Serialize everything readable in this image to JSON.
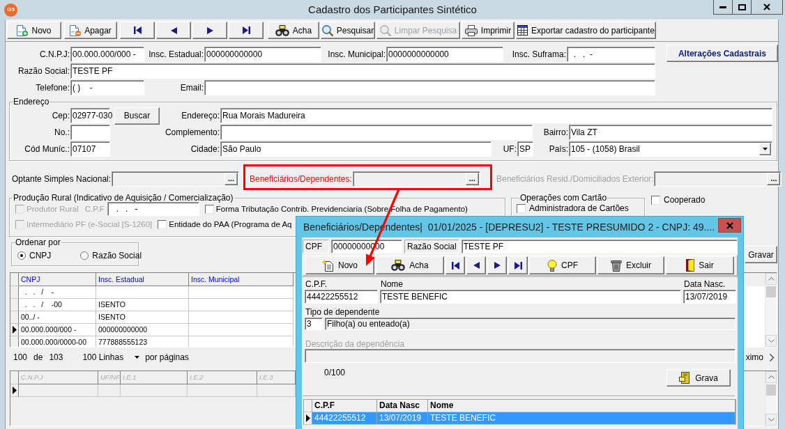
{
  "window": {
    "logo": "G5",
    "title": "Cadastro dos Participantes Sintético"
  },
  "toolbar": [
    {
      "kind": "labeled",
      "label": "Novo",
      "disabled": false
    },
    {
      "kind": "labeled",
      "label": "Apagar",
      "disabled": false
    },
    {
      "kind": "icon",
      "disabled": false
    },
    {
      "kind": "icon",
      "disabled": false
    },
    {
      "kind": "icon",
      "disabled": false
    },
    {
      "kind": "icon",
      "disabled": false
    },
    {
      "kind": "labeled",
      "label": "Acha",
      "disabled": false
    },
    {
      "kind": "labeled",
      "label": "Pesquisar",
      "disabled": false
    },
    {
      "kind": "labeled",
      "label": "Limpar Pesquisa",
      "disabled": true
    },
    {
      "kind": "labeled",
      "label": "Imprimir",
      "disabled": false
    },
    {
      "kind": "labeled",
      "label": "Exportar cadastro do participante",
      "disabled": false
    }
  ],
  "participant": {
    "cnpj": {
      "label": "C.N.P.J:",
      "value": "00.000.000/000 -"
    },
    "insc_estadual": {
      "label": "Insc. Estadual:",
      "value": "000000000000"
    },
    "insc_municipal": {
      "label": "Insc. Municipal:",
      "value": "0000000000000"
    },
    "insc_suframa": {
      "label": "Insc. Suframa:",
      "value": "  .   .  -"
    },
    "changes_button": "Alterações Cadastrais",
    "razao_social": {
      "label": "Razão Social:",
      "value": "TESTE PF"
    },
    "telefone": {
      "label": "Telefone:",
      "value": "( )    -"
    },
    "email": {
      "label": "Email:"
    }
  },
  "address": {
    "title": "Endereço",
    "cep": {
      "label": "Cep:",
      "value": "02977-030"
    },
    "search_button": "Buscar",
    "street": {
      "label": "Endereço:",
      "value": "Rua Morais Madureira"
    },
    "number": {
      "label": "No.:"
    },
    "complement": {
      "label": "Complemento:"
    },
    "district": {
      "label": "Bairro:",
      "value": "Vila ZT"
    },
    "city_code": {
      "label": "Cód Muníc.:",
      "value": "07107"
    },
    "city": {
      "label": "Cidade:",
      "value": "São Paulo"
    },
    "state": {
      "label": "UF:",
      "value": "SP"
    },
    "country": {
      "label": "País:",
      "value": "105 - (1058) Brasil"
    }
  },
  "lookups": [
    {
      "label": "Optante Simples Nacional:",
      "button": "...",
      "disabled": false,
      "highlighted": false
    },
    {
      "label": "Beneficiários/Dependentes:",
      "button": "...",
      "disabled": false,
      "highlighted": true
    },
    {
      "label": "Beneficiários Resid./Domiciliados Exterior:",
      "button": "...",
      "disabled": true,
      "highlighted": false
    }
  ],
  "rural_production": {
    "title": "Produção Rural (Indicativo de Aquisição / Comercialização)",
    "options": [
      {
        "label": "Produtor Rural",
        "checked": false,
        "disabled": true
      },
      {
        "label": "Forma Tributação Contrib. Previdenciaria (Sobre Folha de Pagamento)",
        "checked": false,
        "disabled": false
      },
      {
        "label": "Intermediário PF (e-Social [S-1260]",
        "checked": false,
        "disabled": true
      },
      {
        "label": "Entidade do PAA (Programa de Aq",
        "checked": false,
        "disabled": false
      }
    ],
    "cpf": {
      "label": "C.P.F",
      "value": "   .   .   -",
      "disabled": true
    }
  },
  "card_operations": {
    "title": "Operações com Cartão",
    "options": [
      {
        "label": "Administradora de Cartões",
        "checked": false
      }
    ]
  },
  "cooperado": {
    "label": "Cooperado",
    "checked": false
  },
  "sort_by": {
    "title": "Ordenar por",
    "options": [
      {
        "label": "CNPJ",
        "selected": true
      },
      {
        "label": "Razão Social",
        "selected": false
      }
    ]
  },
  "save_button": "Gravar",
  "participants_table": {
    "columns": [
      "CNPJ",
      "Insc. Estadual",
      "Insc. Municipal"
    ],
    "rows": [
      {
        "cells": [
          "  .   .   /    -"
        ],
        "selected": false
      },
      {
        "cells": [
          "  .   .   /    -00",
          "ISENTO"
        ],
        "selected": false
      },
      {
        "cells": [
          "00../ -",
          "ISENTO"
        ],
        "selected": false
      },
      {
        "cells": [
          "00.000.000/000 -",
          "000000000000"
        ],
        "selected": true
      },
      {
        "cells": [
          "00.000.000/0000-00",
          "777888555123"
        ],
        "selected": false
      }
    ]
  },
  "pagination": {
    "shown": "100",
    "of": "de",
    "total": "103",
    "page_size": "100 Linhas",
    "per_page": "por páginas",
    "next": "ximo"
  },
  "detail_table": {
    "columns": [
      "C.N.P.J",
      "UF/NF",
      "I.E.1",
      "I.E.2",
      "I.E.3"
    ],
    "rows": [
      {
        "selected": true
      }
    ]
  },
  "dialog": {
    "title": "Beneficiários/Dependentes|  01/01/2025 - [DEPRESU2] - TESTE PRESUMIDO 2 - CNPJ: 49....",
    "participant": [
      {
        "label": "CPF",
        "value": "00000000000"
      },
      {
        "label": "Razão Social",
        "value": "TESTE PF"
      }
    ],
    "toolbar": [
      {
        "kind": "labeled",
        "label": "Novo"
      },
      {
        "kind": "labeled",
        "label": "Acha"
      },
      {
        "kind": "icon"
      },
      {
        "kind": "icon"
      },
      {
        "kind": "icon"
      },
      {
        "kind": "icon"
      },
      {
        "kind": "labeled",
        "label": "CPF"
      },
      {
        "kind": "labeled",
        "label": "Excluir"
      },
      {
        "kind": "labeled",
        "label": "Sair"
      }
    ],
    "cpf": {
      "label": "C.P.F.",
      "value": "44422255512"
    },
    "name": {
      "label": "Nome",
      "value": "TESTE BENEFIC"
    },
    "birth_date": {
      "label": "Data Nasc.",
      "value": "13/07/2019"
    },
    "dependent_type": {
      "label": "Tipo de dependente",
      "code": "3",
      "description": "Filho(a) ou enteado(a)"
    },
    "dependency_description": {
      "label": "Descrição da dependência",
      "disabled": true
    },
    "char_count": "0/100",
    "save_button": "Grava",
    "table": {
      "columns": [
        "C.P.F",
        "Data Nasc",
        "Nome"
      ],
      "rows": [
        {
          "cells": [
            "44422255512",
            "13/07/2019",
            "TESTE BENEFIC"
          ],
          "selected": true
        }
      ]
    }
  }
}
